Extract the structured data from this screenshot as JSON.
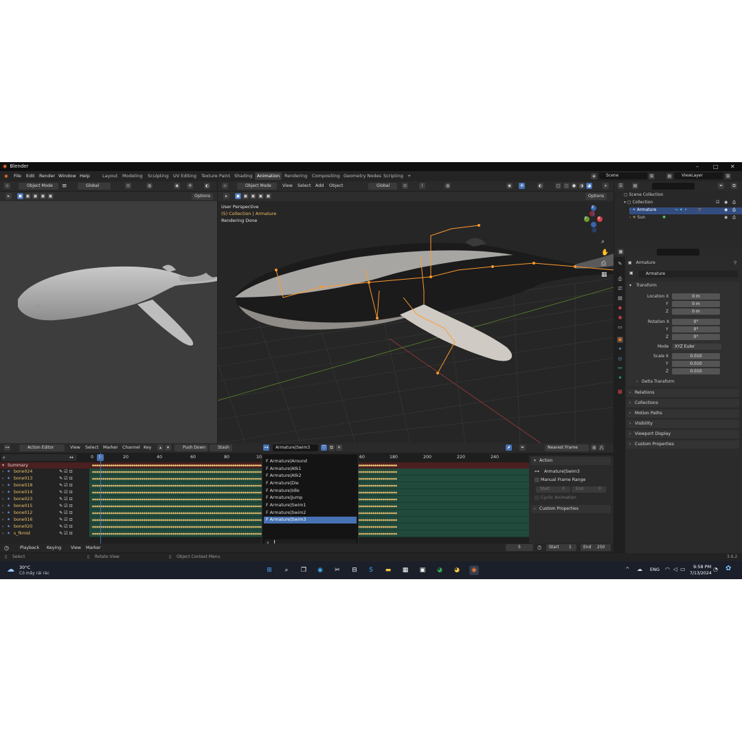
{
  "window": {
    "title": "Blender",
    "minimize": "–",
    "maximize": "□",
    "close": "✕"
  },
  "menu": {
    "items": [
      "File",
      "Edit",
      "Render",
      "Window",
      "Help"
    ],
    "workspaces": [
      "Layout",
      "Modeling",
      "Sculpting",
      "UV Editing",
      "Texture Paint",
      "Shading",
      "Animation",
      "Rendering",
      "Compositing",
      "Geometry Nodes",
      "Scripting"
    ],
    "active_workspace": "Animation",
    "add_tab": "+",
    "scene": "Scene",
    "view_layer": "ViewLayer"
  },
  "left_viewport": {
    "mode": "Object Mode",
    "orientation": "Global",
    "options": "Options"
  },
  "main_viewport": {
    "mode": "Object Mode",
    "menus": [
      "View",
      "Select",
      "Add",
      "Object"
    ],
    "orientation": "Global",
    "options": "Options",
    "overlay_line1": "User Perspective",
    "overlay_line2": "(5) Collection | Armature",
    "overlay_line3": "Rendering Done",
    "gizmo": {
      "x": "X",
      "y": "Y",
      "z": "Z"
    }
  },
  "outliner": {
    "root": "Scene Collection",
    "collection": "Collection",
    "items": [
      "Armature",
      "Sun"
    ]
  },
  "properties": {
    "object_name": "Armature",
    "data_name": "Armature",
    "transform_label": "Transform",
    "location": {
      "label": "Location X",
      "x": "0 m",
      "y": "0 m",
      "z": "0 m"
    },
    "rotation": {
      "label": "Rotation X",
      "x": "0°",
      "y": "0°",
      "z": "0°"
    },
    "axis_y": "Y",
    "axis_z": "Z",
    "mode_label": "Mode",
    "mode_value": "XYZ Euler",
    "scale": {
      "label": "Scale X",
      "x": "0.010",
      "y": "0.010",
      "z": "0.010"
    },
    "delta": "Delta Transform",
    "panels": [
      "Relations",
      "Collections",
      "Motion Paths",
      "Visibility",
      "Viewport Display",
      "Custom Properties"
    ],
    "version": "3.6.2"
  },
  "action_editor": {
    "mode": "Action Editor",
    "menus": [
      "View",
      "Select",
      "Marker",
      "Channel",
      "Key"
    ],
    "push_down": "Push Down",
    "stash": "Stash",
    "action_name": "Armature|Swim3",
    "snap": "Nearest Frame",
    "current_frame_marker": "5",
    "ruler": [
      "0",
      "20",
      "40",
      "60",
      "80",
      "10",
      "60",
      "180",
      "200",
      "220",
      "240"
    ],
    "summary": "Summary",
    "channels": [
      "bone024",
      "bone013",
      "bone018",
      "bone014",
      "bone023",
      "bone015",
      "bone012",
      "bone016",
      "bone020",
      "s_fkmid"
    ],
    "sidebar": {
      "section": "Action",
      "action": "Armature|Swim3",
      "manual_range": "Manual Frame Range",
      "start_label": "Start",
      "start_value": "0",
      "end_label": "End",
      "end_value": "0",
      "cyclic": "Cyclic Animation",
      "custom_props": "Custom Properties"
    }
  },
  "action_dropdown": {
    "items": [
      "F Armature|Around",
      "F Armature|Atk1",
      "F Armature|Atk2",
      "F Armature|Die",
      "F Armature|Idle",
      "F Armature|Jump",
      "F Armature|Swim1",
      "F Armature|Swim2",
      "F Armature|Swim3"
    ],
    "selected_index": 8
  },
  "timeline": {
    "menus": [
      "Playback",
      "Keying",
      "View",
      "Marker"
    ],
    "current_frame": "5",
    "start_label": "Start",
    "start": "1",
    "end_label": "End",
    "end": "250"
  },
  "statusbar": {
    "left": "Select",
    "middle": "Rotate View",
    "right": "Object Context Menu"
  },
  "taskbar": {
    "temp": "30°C",
    "weather": "Có mây rải rác",
    "language": "ENG",
    "time": "9:58 PM",
    "date": "7/13/2024"
  },
  "colors": {
    "accent": "#4772b3",
    "keyframe": "#f0c070",
    "bone": "#ff9a2e",
    "channel_text": "#e8c06a"
  }
}
